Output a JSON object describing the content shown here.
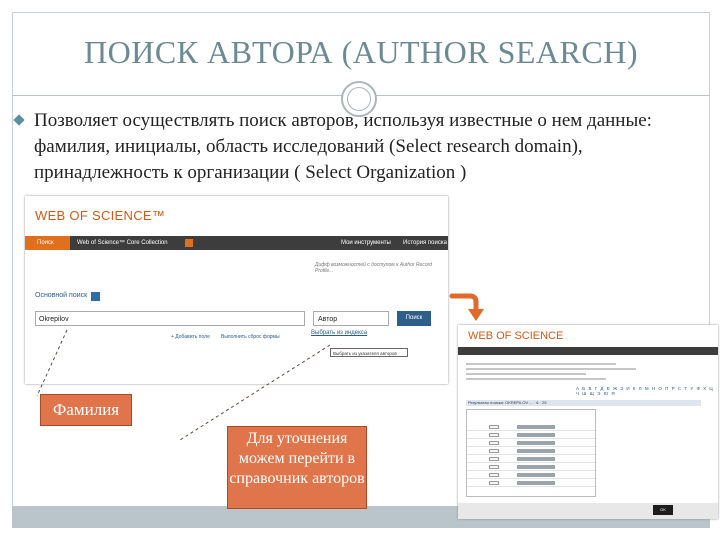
{
  "slide": {
    "title": "ПОИСК АВТОРА (AUTHOR SEARCH)",
    "paragraph": "Позволяет  осуществлять поиск авторов, используя известные о нем данные:  фамилия, инициалы, область исследований (Select  research domain),  принадлежность к  организации ( Select Organization )"
  },
  "wos_main": {
    "logo": "WEB OF SCIENCE™",
    "nav_tab": "Поиск",
    "collection": "Web of Science™ Core Collection",
    "tools": "Мои инструменты",
    "history": "История поиска",
    "note": "Дифф возможностей с доступом к Author Record Profile...",
    "basic_search": "Основной поиск",
    "search_value": "Okrepilov",
    "field_select": "Автор",
    "search_button": "Поиск",
    "add_field": "+ Добавить поле",
    "select_field": "Выполнить сброс формы",
    "index_link": "Выбрать из индекса",
    "tooltip": "Выбрать из указателя авторов"
  },
  "wos_index": {
    "logo": "WEB OF SCIENCE",
    "letters": "А Б В Г Д Е Ж З И К Л М Н О П Р С Т У Ф Х Ц Ч Ш Щ Э Ю Я",
    "results_head": "Результаты поиска: OKREPILOV ... · 6 · 25",
    "ok_button": "OK"
  },
  "callouts": {
    "surname": "Фамилия",
    "refine": "Для уточнения можем перейти в справочник авторов"
  },
  "colors": {
    "title": "#6c8a94",
    "accent_orange": "#e0744a",
    "wos_orange": "#d35a14",
    "wos_blue": "#2e5f8a"
  }
}
